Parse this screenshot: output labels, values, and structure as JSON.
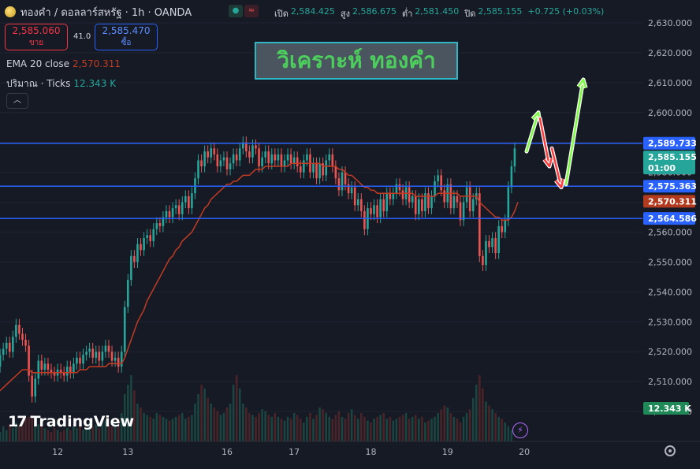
{
  "header": {
    "symbol": "ทองคำ / ดอลลาร์สหรัฐ · 1h · OANDA",
    "open_label": "เปิด",
    "open": "2,584.425",
    "high_label": "สูง",
    "high": "2,586.675",
    "low_label": "ต่ำ",
    "low": "2,581.450",
    "close_label": "ปิด",
    "close": "2,585.155",
    "change": "+0.725 (+0.03%)"
  },
  "trade": {
    "sell_price": "2,585.060",
    "sell_label": "ขาย",
    "spread": "41.0",
    "buy_price": "2,585.470",
    "buy_label": "ซื้อ"
  },
  "indicators": {
    "ema_label": "EMA 20 close",
    "ema_value": "2,570.311",
    "volume_label": "ปริมาณ · Ticks",
    "volume_value": "12.343 K"
  },
  "overlay_title": "วิเคราะห์ ทองคำ",
  "brand": "TradingView",
  "colors": {
    "background": "#161a25",
    "up": "#26a69a",
    "down": "#ef5350",
    "ema": "#c23b22",
    "level_line": "#2962ff",
    "title_text": "#4ccf5c",
    "title_border": "#2fb7c6",
    "arrow_up": "#7CFC3E",
    "arrow_down": "#ff3b3b"
  },
  "chart_data": {
    "type": "candlestick",
    "ylim": [
      2490,
      2635
    ],
    "yticks": [
      2500,
      2510,
      2520,
      2530,
      2540,
      2550,
      2560,
      2570,
      2580,
      2590,
      2600,
      2610,
      2620,
      2630
    ],
    "ytick_labels": [
      "2,500.000",
      "2,510.000",
      "2,520.000",
      "2,530.000",
      "2,540.000",
      "2,550.000",
      "2,560.000",
      "2,570.000",
      "2,580.000",
      "2,590.000",
      "2,600.000",
      "2,610.000",
      "2,620.000",
      "2,630.000"
    ],
    "x_labels": [
      "12",
      "13",
      "16",
      "17",
      "18",
      "19",
      "20"
    ],
    "x_label_index": [
      20,
      42,
      73,
      94,
      118,
      142,
      166
    ],
    "series_close": [
      2517,
      2515,
      2519,
      2521,
      2523,
      2520,
      2525,
      2529,
      2526,
      2524,
      2522,
      2512,
      2505,
      2511,
      2517,
      2514,
      2516,
      2514,
      2513,
      2512,
      2514,
      2513,
      2512,
      2515,
      2513,
      2516,
      2518,
      2516,
      2519,
      2520,
      2521,
      2518,
      2520,
      2517,
      2520,
      2522,
      2520,
      2517,
      2518,
      2515,
      2520,
      2535,
      2544,
      2552,
      2550,
      2556,
      2554,
      2558,
      2559,
      2557,
      2561,
      2563,
      2562,
      2565,
      2567,
      2565,
      2568,
      2569,
      2566,
      2570,
      2572,
      2568,
      2573,
      2578,
      2584,
      2582,
      2587,
      2585,
      2588,
      2586,
      2582,
      2584,
      2585,
      2581,
      2583,
      2586,
      2584,
      2588,
      2590,
      2587,
      2585,
      2589,
      2588,
      2582,
      2585,
      2587,
      2583,
      2586,
      2584,
      2586,
      2582,
      2584,
      2586,
      2583,
      2585,
      2582,
      2580,
      2584,
      2586,
      2580,
      2583,
      2578,
      2583,
      2579,
      2584,
      2586,
      2582,
      2578,
      2574,
      2580,
      2576,
      2573,
      2575,
      2569,
      2571,
      2567,
      2561,
      2568,
      2566,
      2569,
      2565,
      2571,
      2567,
      2573,
      2571,
      2573,
      2576,
      2574,
      2571,
      2575,
      2570,
      2572,
      2566,
      2571,
      2567,
      2573,
      2568,
      2572,
      2577,
      2579,
      2574,
      2570,
      2576,
      2568,
      2572,
      2570,
      2564,
      2570,
      2575,
      2567,
      2571,
      2573,
      2552,
      2549,
      2557,
      2555,
      2558,
      2553,
      2562,
      2560,
      2564,
      2575,
      2582,
      2588
    ],
    "series_open": [
      2519,
      2517,
      2515,
      2519,
      2521,
      2523,
      2520,
      2525,
      2529,
      2526,
      2524,
      2522,
      2512,
      2505,
      2511,
      2517,
      2514,
      2516,
      2514,
      2513,
      2512,
      2514,
      2513,
      2512,
      2515,
      2513,
      2516,
      2518,
      2516,
      2519,
      2520,
      2521,
      2518,
      2520,
      2517,
      2520,
      2522,
      2520,
      2517,
      2518,
      2515,
      2520,
      2535,
      2544,
      2552,
      2550,
      2556,
      2554,
      2558,
      2559,
      2557,
      2561,
      2563,
      2562,
      2565,
      2567,
      2565,
      2568,
      2569,
      2566,
      2570,
      2572,
      2568,
      2573,
      2578,
      2584,
      2582,
      2587,
      2585,
      2588,
      2586,
      2582,
      2584,
      2585,
      2581,
      2583,
      2586,
      2584,
      2588,
      2590,
      2587,
      2585,
      2589,
      2588,
      2582,
      2585,
      2587,
      2583,
      2586,
      2584,
      2586,
      2582,
      2584,
      2586,
      2583,
      2585,
      2582,
      2580,
      2584,
      2586,
      2580,
      2583,
      2578,
      2583,
      2579,
      2584,
      2586,
      2582,
      2578,
      2574,
      2580,
      2576,
      2573,
      2575,
      2569,
      2571,
      2567,
      2561,
      2568,
      2566,
      2569,
      2565,
      2571,
      2567,
      2573,
      2571,
      2573,
      2576,
      2574,
      2571,
      2575,
      2570,
      2572,
      2566,
      2571,
      2567,
      2573,
      2568,
      2572,
      2577,
      2579,
      2574,
      2570,
      2576,
      2568,
      2572,
      2570,
      2564,
      2570,
      2575,
      2567,
      2571,
      2573,
      2552,
      2549,
      2557,
      2555,
      2558,
      2553,
      2562,
      2560,
      2564,
      2575,
      2582
    ],
    "ema20": [
      2505,
      2506,
      2507,
      2508,
      2509,
      2510,
      2511,
      2512,
      2513,
      2514,
      2514,
      2514,
      2513,
      2513,
      2513,
      2513,
      2513,
      2513,
      2513,
      2513,
      2513,
      2513,
      2513,
      2513,
      2513,
      2513,
      2513,
      2514,
      2514,
      2514,
      2515,
      2515,
      2515,
      2515,
      2515,
      2515,
      2516,
      2516,
      2516,
      2516,
      2516,
      2518,
      2521,
      2524,
      2527,
      2530,
      2532,
      2534,
      2537,
      2539,
      2541,
      2543,
      2545,
      2547,
      2549,
      2551,
      2552,
      2554,
      2555,
      2557,
      2558,
      2559,
      2560,
      2562,
      2564,
      2566,
      2568,
      2569,
      2571,
      2572,
      2573,
      2574,
      2575,
      2576,
      2576,
      2577,
      2577,
      2578,
      2579,
      2579,
      2579,
      2580,
      2581,
      2581,
      2581,
      2582,
      2582,
      2582,
      2582,
      2582,
      2582,
      2582,
      2582,
      2583,
      2583,
      2583,
      2583,
      2583,
      2583,
      2583,
      2583,
      2583,
      2583,
      2582,
      2582,
      2582,
      2582,
      2582,
      2581,
      2581,
      2580,
      2579,
      2579,
      2578,
      2577,
      2576,
      2575,
      2575,
      2574,
      2574,
      2573,
      2573,
      2573,
      2573,
      2573,
      2573,
      2573,
      2573,
      2573,
      2573,
      2573,
      2573,
      2572,
      2572,
      2572,
      2572,
      2572,
      2572,
      2572,
      2573,
      2573,
      2573,
      2573,
      2573,
      2573,
      2573,
      2572,
      2572,
      2572,
      2572,
      2572,
      2572,
      2570,
      2569,
      2568,
      2567,
      2566,
      2565,
      2565,
      2564,
      2564,
      2564,
      2565,
      2567,
      2570
    ],
    "volume": [
      12,
      14,
      10,
      16,
      12,
      18,
      14,
      20,
      16,
      22,
      24,
      26,
      28,
      20,
      18,
      16,
      14,
      12,
      10,
      14,
      12,
      10,
      12,
      14,
      12,
      16,
      14,
      18,
      12,
      14,
      20,
      16,
      18,
      14,
      20,
      22,
      18,
      16,
      20,
      24,
      30,
      50,
      60,
      70,
      54,
      40,
      36,
      30,
      28,
      26,
      24,
      30,
      28,
      26,
      24,
      22,
      24,
      26,
      28,
      30,
      24,
      26,
      28,
      40,
      50,
      60,
      56,
      46,
      40,
      36,
      32,
      28,
      30,
      36,
      40,
      60,
      70,
      56,
      40,
      36,
      30,
      28,
      26,
      30,
      34,
      32,
      28,
      26,
      30,
      26,
      24,
      22,
      26,
      24,
      30,
      28,
      24,
      20,
      26,
      30,
      24,
      28,
      36,
      34,
      30,
      26,
      24,
      28,
      32,
      26,
      24,
      30,
      34,
      28,
      24,
      30,
      26,
      22,
      20,
      24,
      26,
      28,
      30,
      24,
      26,
      22,
      24,
      26,
      28,
      30,
      24,
      26,
      28,
      24,
      26,
      20,
      22,
      24,
      26,
      30,
      34,
      38,
      36,
      30,
      26,
      24,
      20,
      26,
      30,
      34,
      46,
      60,
      70,
      56,
      42,
      38,
      34,
      30,
      26,
      24,
      20,
      16,
      12
    ],
    "levels": [
      2589.733,
      2575.363,
      2564.586
    ],
    "level_labels": [
      "2,589.733",
      "2,575.363",
      "2,564.586"
    ],
    "price_tag": "2,585.155",
    "countdown": "01:00",
    "ema_tag": "2,570.311",
    "volume_tag": "12.343 K",
    "projection": {
      "up1": [
        2587,
        2600
      ],
      "down1": [
        2598,
        2582
      ],
      "down2": [
        2588,
        2575
      ],
      "up2": [
        2576,
        2611
      ]
    }
  }
}
